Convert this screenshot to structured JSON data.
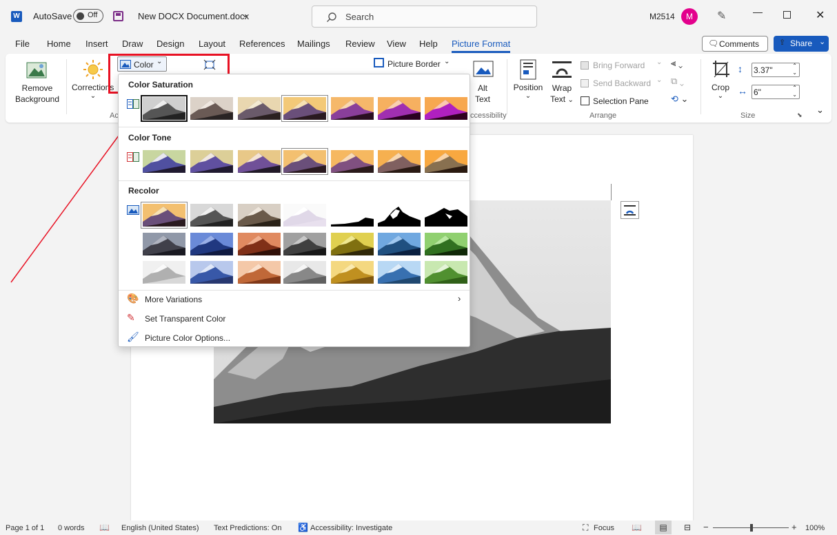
{
  "titlebar": {
    "autosave_label": "AutoSave",
    "toggle_state": "Off",
    "doc_title": "New DOCX Document.docx",
    "search_placeholder": "Search",
    "user_id": "M2514",
    "avatar_initial": "M"
  },
  "tabs": [
    "File",
    "Home",
    "Insert",
    "Draw",
    "Design",
    "Layout",
    "References",
    "Mailings",
    "Review",
    "View",
    "Help",
    "Picture Format"
  ],
  "active_tab": "Picture Format",
  "actions": {
    "comments": "Comments",
    "share": "Share"
  },
  "ribbon": {
    "remove_bg_1": "Remove",
    "remove_bg_2": "Background",
    "corrections": "Corrections",
    "color_btn": "Color",
    "picture_border": "Picture Border",
    "alt_text_1": "Alt",
    "alt_text_2": "Text",
    "accessibility_group": "ccessibility",
    "adjust_group": "Ac",
    "position": "Position",
    "wrap_text_1": "Wrap",
    "wrap_text_2": "Text",
    "bring_forward": "Bring Forward",
    "send_backward": "Send Backward",
    "selection_pane": "Selection Pane",
    "arrange_group": "Arrange",
    "crop": "Crop",
    "height": "3.37\"",
    "width": "6\"",
    "size_group": "Size"
  },
  "dropdown": {
    "color_saturation": "Color Saturation",
    "color_tone": "Color Tone",
    "recolor": "Recolor",
    "more_variations": "More Variations",
    "set_transparent": "Set Transparent Color",
    "picture_color_options": "Picture Color Options..."
  },
  "status": {
    "page": "Page 1 of 1",
    "words": "0 words",
    "language": "English (United States)",
    "text_predictions": "Text Predictions: On",
    "accessibility": "Accessibility: Investigate",
    "focus": "Focus",
    "zoom": "100%"
  },
  "colors": {
    "accent": "#185abd",
    "highlight": "#e81123",
    "annotation": "#e81123"
  }
}
